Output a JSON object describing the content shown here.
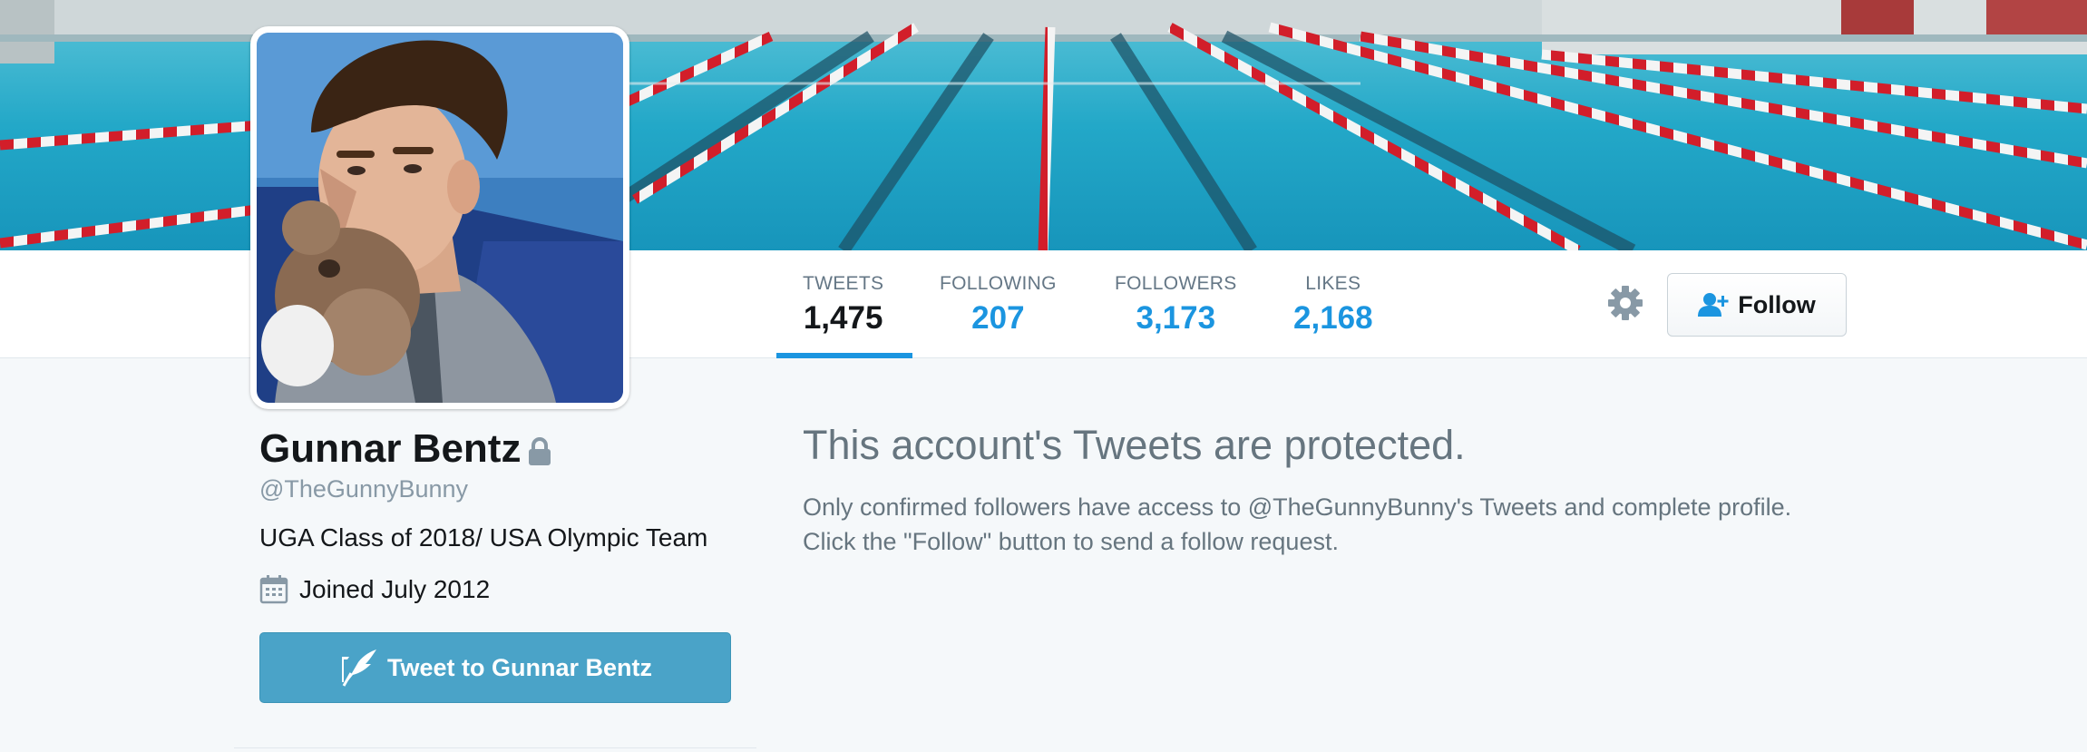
{
  "profile": {
    "name": "Gunnar Bentz",
    "handle": "@TheGunnyBunny",
    "bio": "UGA Class of 2018/ USA Olympic Team",
    "joined": "Joined July 2012",
    "locked_icon": "lock-icon",
    "calendar_icon": "calendar-icon"
  },
  "stats": [
    {
      "label": "TWEETS",
      "value": "1,475"
    },
    {
      "label": "FOLLOWING",
      "value": "207"
    },
    {
      "label": "FOLLOWERS",
      "value": "3,173"
    },
    {
      "label": "LIKES",
      "value": "2,168"
    }
  ],
  "actions": {
    "follow_label": "Follow",
    "follow_icon": "add-person-icon",
    "settings_icon": "gear-icon",
    "tweet_to_label": "Tweet to Gunnar Bentz",
    "tweet_to_icon": "quill-icon"
  },
  "protected": {
    "title": "This account's Tweets are protected.",
    "line1": "Only confirmed followers have access to @TheGunnyBunny's Tweets and complete profile.",
    "line2": "Click the \"Follow\" button to send a follow request."
  },
  "colors": {
    "accent": "#1b95e0",
    "tweet_button": "#4aa3c8",
    "background": "#f5f8fa",
    "muted_text": "#66757f"
  }
}
